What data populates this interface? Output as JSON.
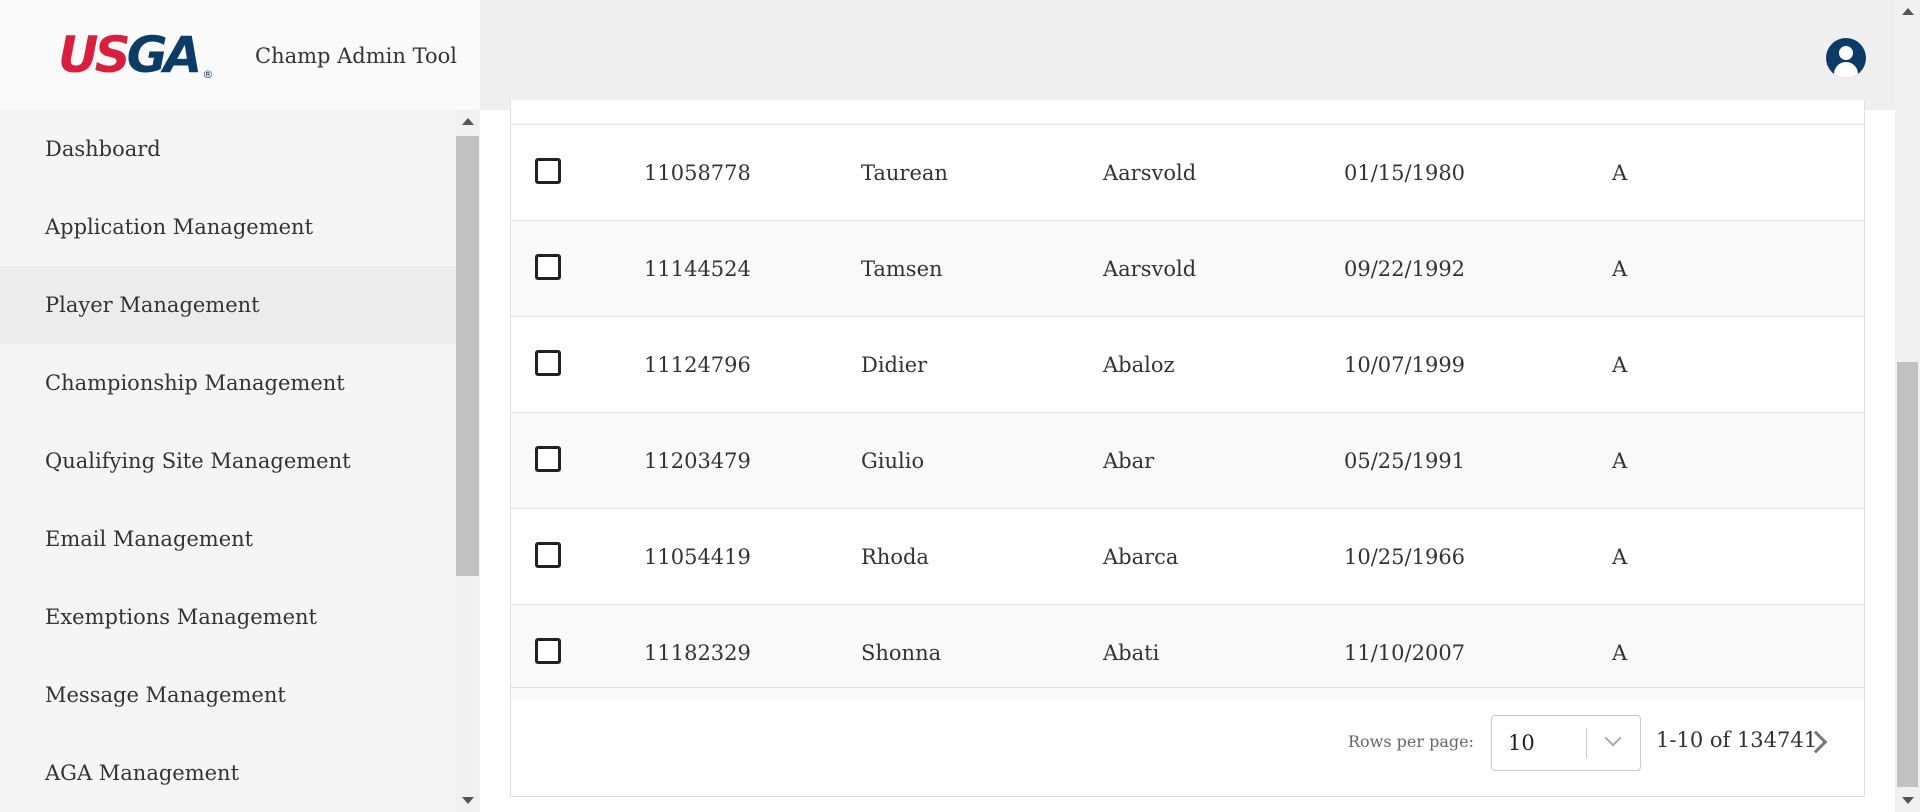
{
  "brand": {
    "logo_us": "US",
    "logo_ga": "GA",
    "logo_reg": "®",
    "app_title": "Champ Admin Tool"
  },
  "sidebar": {
    "items": [
      {
        "label": "Dashboard",
        "active": false
      },
      {
        "label": "Application Management",
        "active": false
      },
      {
        "label": "Player Management",
        "active": true
      },
      {
        "label": "Championship Management",
        "active": false
      },
      {
        "label": "Qualifying Site Management",
        "active": false
      },
      {
        "label": "Email Management",
        "active": false
      },
      {
        "label": "Exemptions Management",
        "active": false
      },
      {
        "label": "Message Management",
        "active": false
      },
      {
        "label": "AGA Management",
        "active": false
      }
    ]
  },
  "header": {
    "user_icon": "user-account-icon"
  },
  "table": {
    "rows": [
      {
        "id": "11058778",
        "first": "Taurean",
        "last": "Aarsvold",
        "dob": "01/15/1980",
        "status": "A",
        "checked": false
      },
      {
        "id": "11144524",
        "first": "Tamsen",
        "last": "Aarsvold",
        "dob": "09/22/1992",
        "status": "A",
        "checked": false
      },
      {
        "id": "11124796",
        "first": "Didier",
        "last": "Abaloz",
        "dob": "10/07/1999",
        "status": "A",
        "checked": false
      },
      {
        "id": "11203479",
        "first": "Giulio",
        "last": "Abar",
        "dob": "05/25/1991",
        "status": "A",
        "checked": false
      },
      {
        "id": "11054419",
        "first": "Rhoda",
        "last": "Abarca",
        "dob": "10/25/1966",
        "status": "A",
        "checked": false
      },
      {
        "id": "11182329",
        "first": "Shonna",
        "last": "Abati",
        "dob": "11/10/2007",
        "status": "A",
        "checked": false
      }
    ]
  },
  "pagination": {
    "rows_per_page_label": "Rows per page:",
    "rows_per_page_value": "10",
    "range_text": "1-10 of 134741"
  },
  "colors": {
    "brand_red": "#d81f3e",
    "brand_navy": "#0b3b66"
  }
}
